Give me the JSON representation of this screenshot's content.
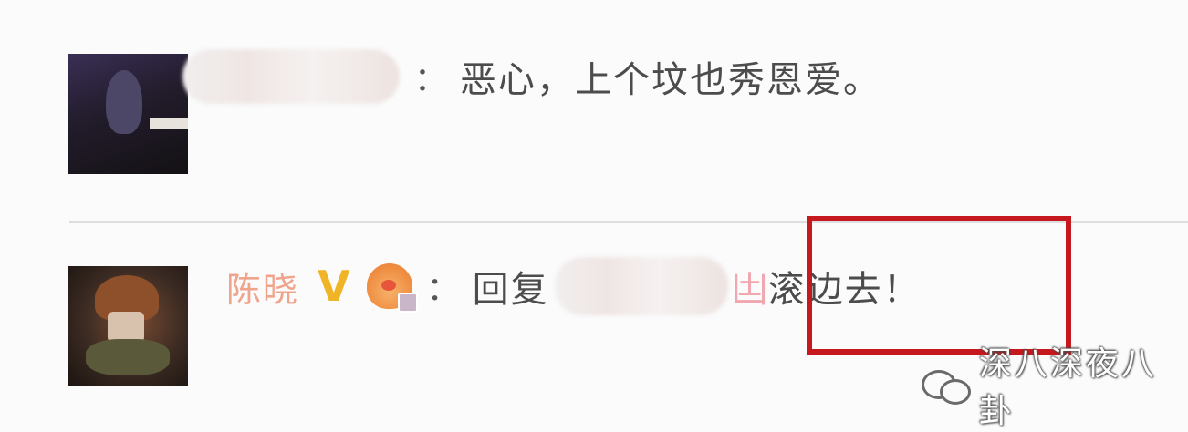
{
  "comments": [
    {
      "text": "恶心，上个坟也秀恩爱。",
      "colon": "："
    },
    {
      "user_name": "陈晓",
      "verified_badge": "V",
      "colon": "：",
      "reply_prefix": "回复",
      "pink_mark": "凷",
      "text": "滚边去！"
    }
  ],
  "highlight": {
    "color": "#c6191f"
  },
  "watermark": {
    "text": "深八深夜八卦"
  },
  "colors": {
    "user_name": "#f0a48c",
    "verified": "#f0b526"
  }
}
